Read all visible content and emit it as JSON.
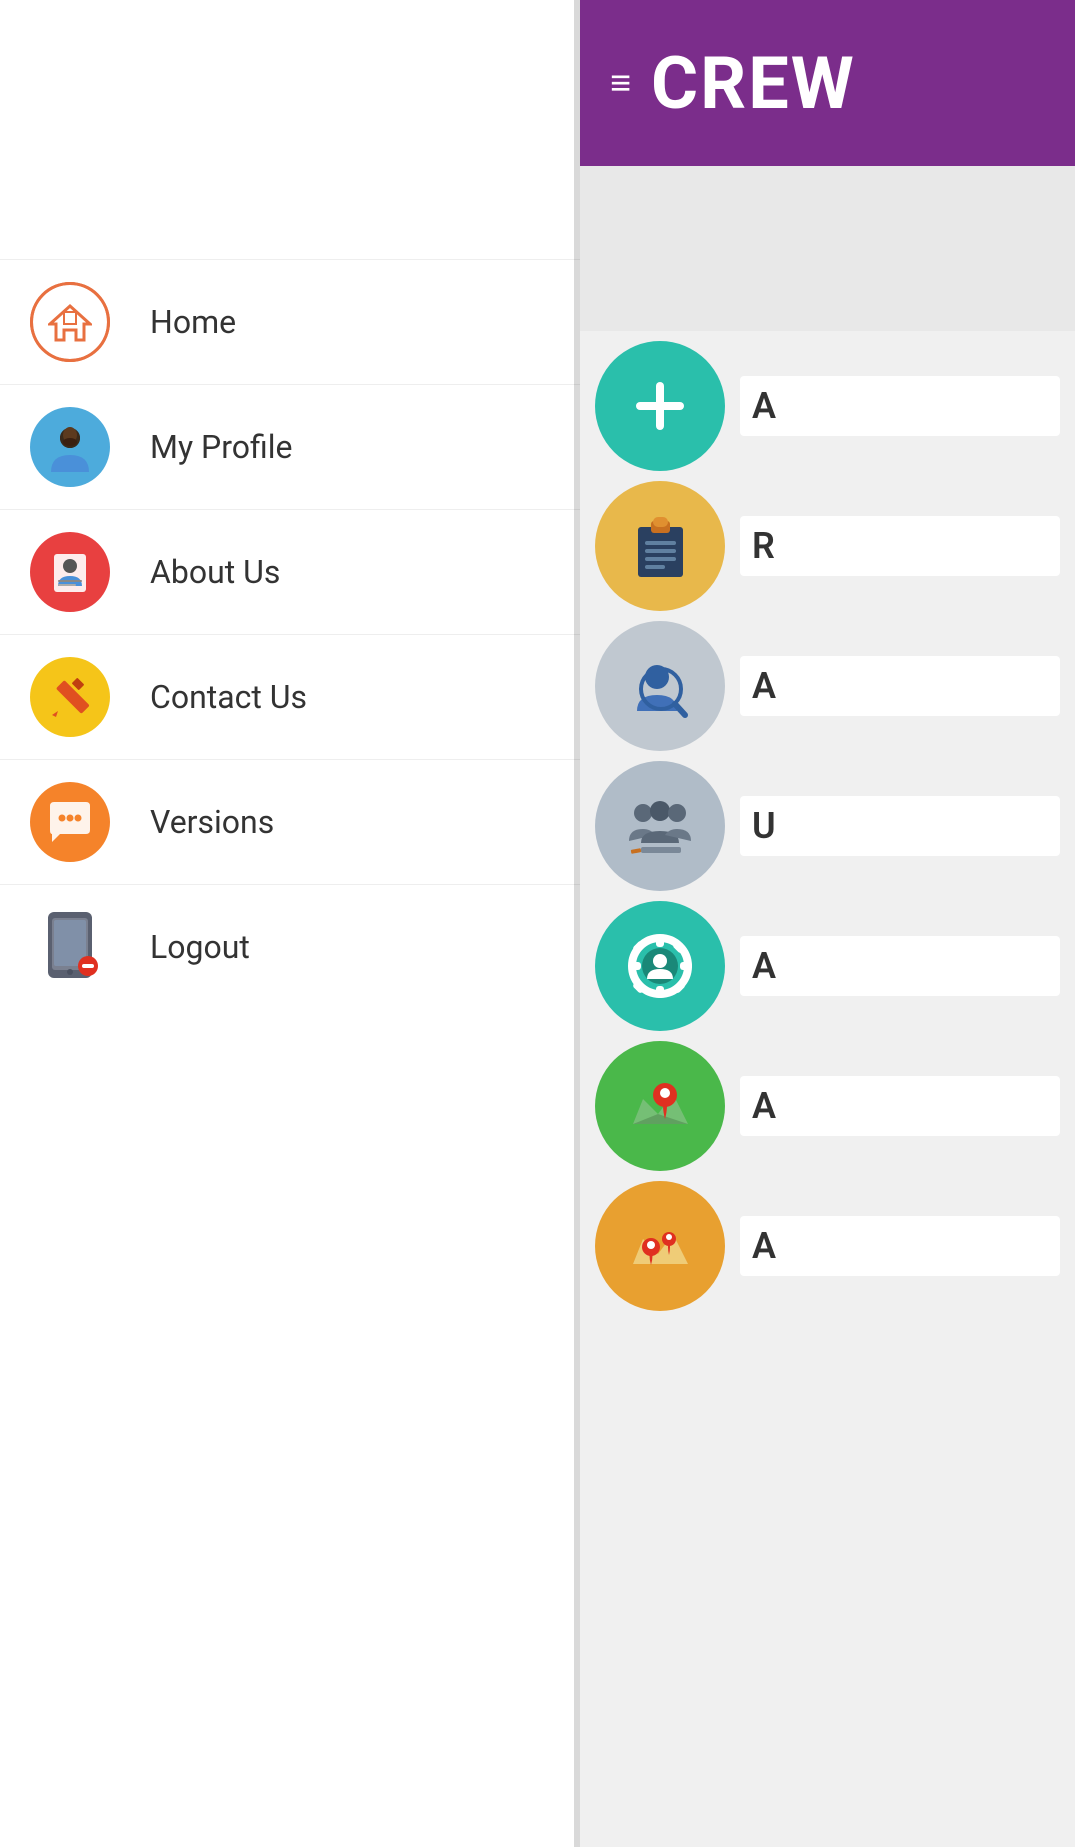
{
  "header": {
    "title": "CREW",
    "hamburger_label": "≡",
    "background_color": "#7b2d8b"
  },
  "drawer": {
    "nav_items": [
      {
        "id": "home",
        "label": "Home",
        "icon": "home-icon",
        "icon_bg": "transparent",
        "icon_border": "#e87040",
        "icon_emoji": "🏠"
      },
      {
        "id": "my-profile",
        "label": "My Profile",
        "icon": "profile-icon",
        "icon_bg": "#4dabdc",
        "icon_emoji": "👤"
      },
      {
        "id": "about-us",
        "label": "About Us",
        "icon": "about-icon",
        "icon_bg": "#e84040",
        "icon_emoji": "📋"
      },
      {
        "id": "contact-us",
        "label": "Contact Us",
        "icon": "contact-icon",
        "icon_bg": "#f5c519",
        "icon_emoji": "✏️"
      },
      {
        "id": "versions",
        "label": "Versions",
        "icon": "versions-icon",
        "icon_bg": "#f5832a",
        "icon_emoji": "💬"
      },
      {
        "id": "logout",
        "label": "Logout",
        "icon": "logout-icon",
        "icon_bg": "transparent",
        "icon_emoji": "📱"
      }
    ]
  },
  "main_grid": {
    "items": [
      {
        "id": "add",
        "icon": "plus-icon",
        "icon_bg": "#2abfab",
        "symbol": "+",
        "label": "A"
      },
      {
        "id": "reports",
        "icon": "clipboard-icon",
        "icon_bg": "#e8b84b",
        "symbol": "📋",
        "label": "R"
      },
      {
        "id": "search-person",
        "icon": "search-person-icon",
        "icon_bg": "#c0c8d0",
        "symbol": "🔍",
        "label": "A"
      },
      {
        "id": "users-edit",
        "icon": "users-edit-icon",
        "icon_bg": "#b0bcc8",
        "symbol": "👥",
        "label": "U"
      },
      {
        "id": "admin-settings",
        "icon": "admin-gear-icon",
        "icon_bg": "#2abfab",
        "symbol": "⚙️",
        "label": "A"
      },
      {
        "id": "location",
        "icon": "location-icon",
        "icon_bg": "#4ab84a",
        "symbol": "📍",
        "label": "A"
      },
      {
        "id": "location2",
        "icon": "location2-icon",
        "icon_bg": "#e8a030",
        "symbol": "📍",
        "label": "A"
      }
    ]
  }
}
